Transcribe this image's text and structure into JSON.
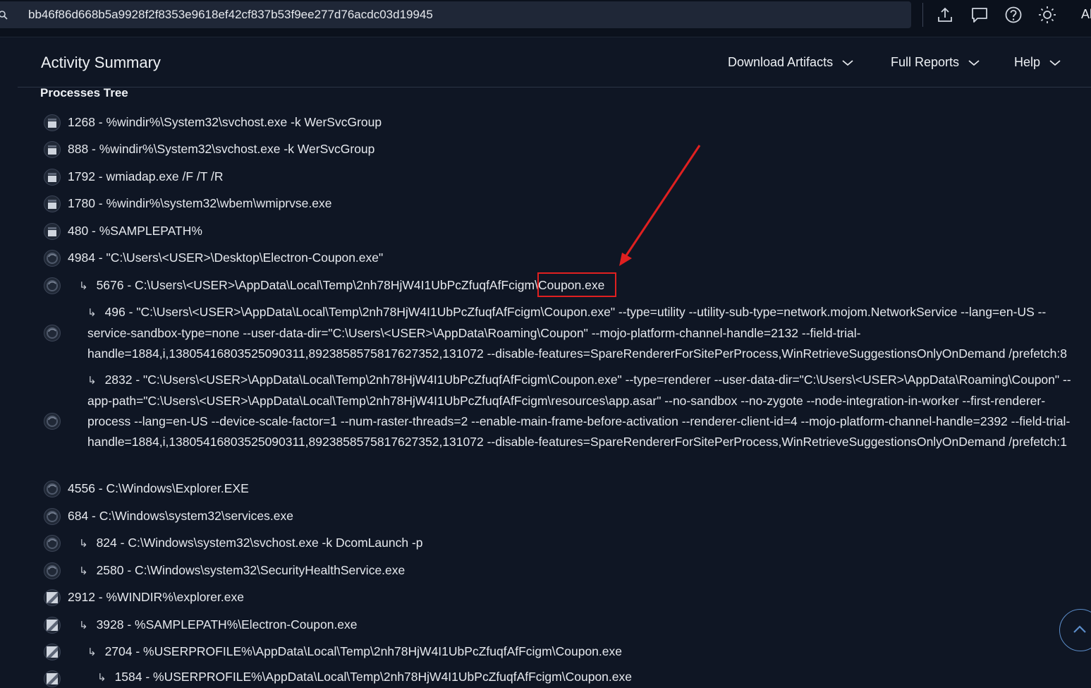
{
  "search": {
    "value": "bb46f86d668b5a9928f2f8353e9618ef42cf837b53f9ee277d76acdc03d19945"
  },
  "toolbar": {
    "icons": [
      "upload-icon",
      "comment-icon",
      "help-circle-icon",
      "sun-icon"
    ],
    "truncated_label": "Al"
  },
  "header": {
    "title": "Activity Summary",
    "nav": [
      {
        "label": "Download Artifacts"
      },
      {
        "label": "Full Reports"
      },
      {
        "label": "Help"
      }
    ]
  },
  "tree": {
    "title": "Processes Tree",
    "rows": [
      {
        "indent": 0,
        "icon": "svchost-icon",
        "text": "1268 - %windir%\\System32\\svchost.exe -k WerSvcGroup"
      },
      {
        "indent": 0,
        "icon": "svchost-icon",
        "text": "888 - %windir%\\System32\\svchost.exe -k WerSvcGroup"
      },
      {
        "indent": 0,
        "icon": "svchost-icon",
        "text": "1792 - wmiadap.exe /F /T /R"
      },
      {
        "indent": 0,
        "icon": "svchost-icon",
        "text": "1780 - %windir%\\system32\\wbem\\wmiprvse.exe"
      },
      {
        "indent": 0,
        "icon": "svchost-icon",
        "text": "480 - %SAMPLEPATH%"
      },
      {
        "indent": 0,
        "icon": "electron-icon",
        "text": "4984 - \"C:\\Users\\<USER>\\Desktop\\Electron-Coupon.exe\""
      },
      {
        "indent": 1,
        "icon": "electron-icon",
        "text_pre": "5676 - C:\\Users\\<USER>\\AppData\\Local\\Temp\\2nh78HjW4I1UbPcZfuqfAfFcigm",
        "text_hl": "\\Coupon.exe"
      },
      {
        "indent": 2,
        "icon": "electron-icon",
        "text": "496 - \"C:\\Users\\<USER>\\AppData\\Local\\Temp\\2nh78HjW4I1UbPcZfuqfAfFcigm\\Coupon.exe\" --type=utility --utility-sub-type=network.mojom.NetworkService --lang=en-US --service-sandbox-type=none --user-data-dir=\"C:\\Users\\<USER>\\AppData\\Roaming\\Coupon\" --mojo-platform-channel-handle=2132 --field-trial-handle=1884,i,13805416803525090311,8923858575817627352,131072 --disable-features=SpareRendererForSitePerProcess,WinRetrieveSuggestionsOnlyOnDemand /prefetch:8"
      },
      {
        "indent": 2,
        "icon": "electron-icon",
        "text": "2832 - \"C:\\Users\\<USER>\\AppData\\Local\\Temp\\2nh78HjW4I1UbPcZfuqfAfFcigm\\Coupon.exe\" --type=renderer --user-data-dir=\"C:\\Users\\<USER>\\AppData\\Roaming\\Coupon\" --app-path=\"C:\\Users\\<USER>\\AppData\\Local\\Temp\\2nh78HjW4I1UbPcZfuqfAfFcigm\\resources\\app.asar\" --no-sandbox --no-zygote --node-integration-in-worker --first-renderer-process --lang=en-US --device-scale-factor=1 --num-raster-threads=2 --enable-main-frame-before-activation --renderer-client-id=4 --mojo-platform-channel-handle=2392 --field-trial-handle=1884,i,13805416803525090311,8923858575817627352,131072 --disable-features=SpareRendererForSitePerProcess,WinRetrieveSuggestionsOnlyOnDemand /prefetch:1"
      },
      {
        "indent": 0,
        "icon": "electron-icon",
        "text": "4556 - C:\\Windows\\Explorer.EXE"
      },
      {
        "indent": 0,
        "icon": "electron-icon",
        "text": "684 - C:\\Windows\\system32\\services.exe"
      },
      {
        "indent": 1,
        "icon": "electron-icon",
        "text": "824 - C:\\Windows\\system32\\svchost.exe -k DcomLaunch -p"
      },
      {
        "indent": 1,
        "icon": "electron-icon",
        "text": "2580 - C:\\Windows\\system32\\SecurityHealthService.exe"
      },
      {
        "indent": 0,
        "icon": "explorer-icon",
        "text": "2912 - %WINDIR%\\explorer.exe"
      },
      {
        "indent": 1,
        "icon": "explorer-icon",
        "text": "3928 - %SAMPLEPATH%\\Electron-Coupon.exe"
      },
      {
        "indent": 2,
        "icon": "explorer-icon",
        "text": "2704 - %USERPROFILE%\\AppData\\Local\\Temp\\2nh78HjW4I1UbPcZfuqfAfFcigm\\Coupon.exe"
      },
      {
        "indent": 3,
        "icon": "explorer-icon",
        "text": "1584 - %USERPROFILE%\\AppData\\Local\\Temp\\2nh78HjW4I1UbPcZfuqfAfFcigm\\Coupon.exe"
      }
    ]
  },
  "colors": {
    "background": "#0f1624",
    "topbar": "#0b111c",
    "search_field": "#1f2737",
    "annotation_red": "#e02020",
    "scroll_button_border": "#5b8cc8"
  }
}
